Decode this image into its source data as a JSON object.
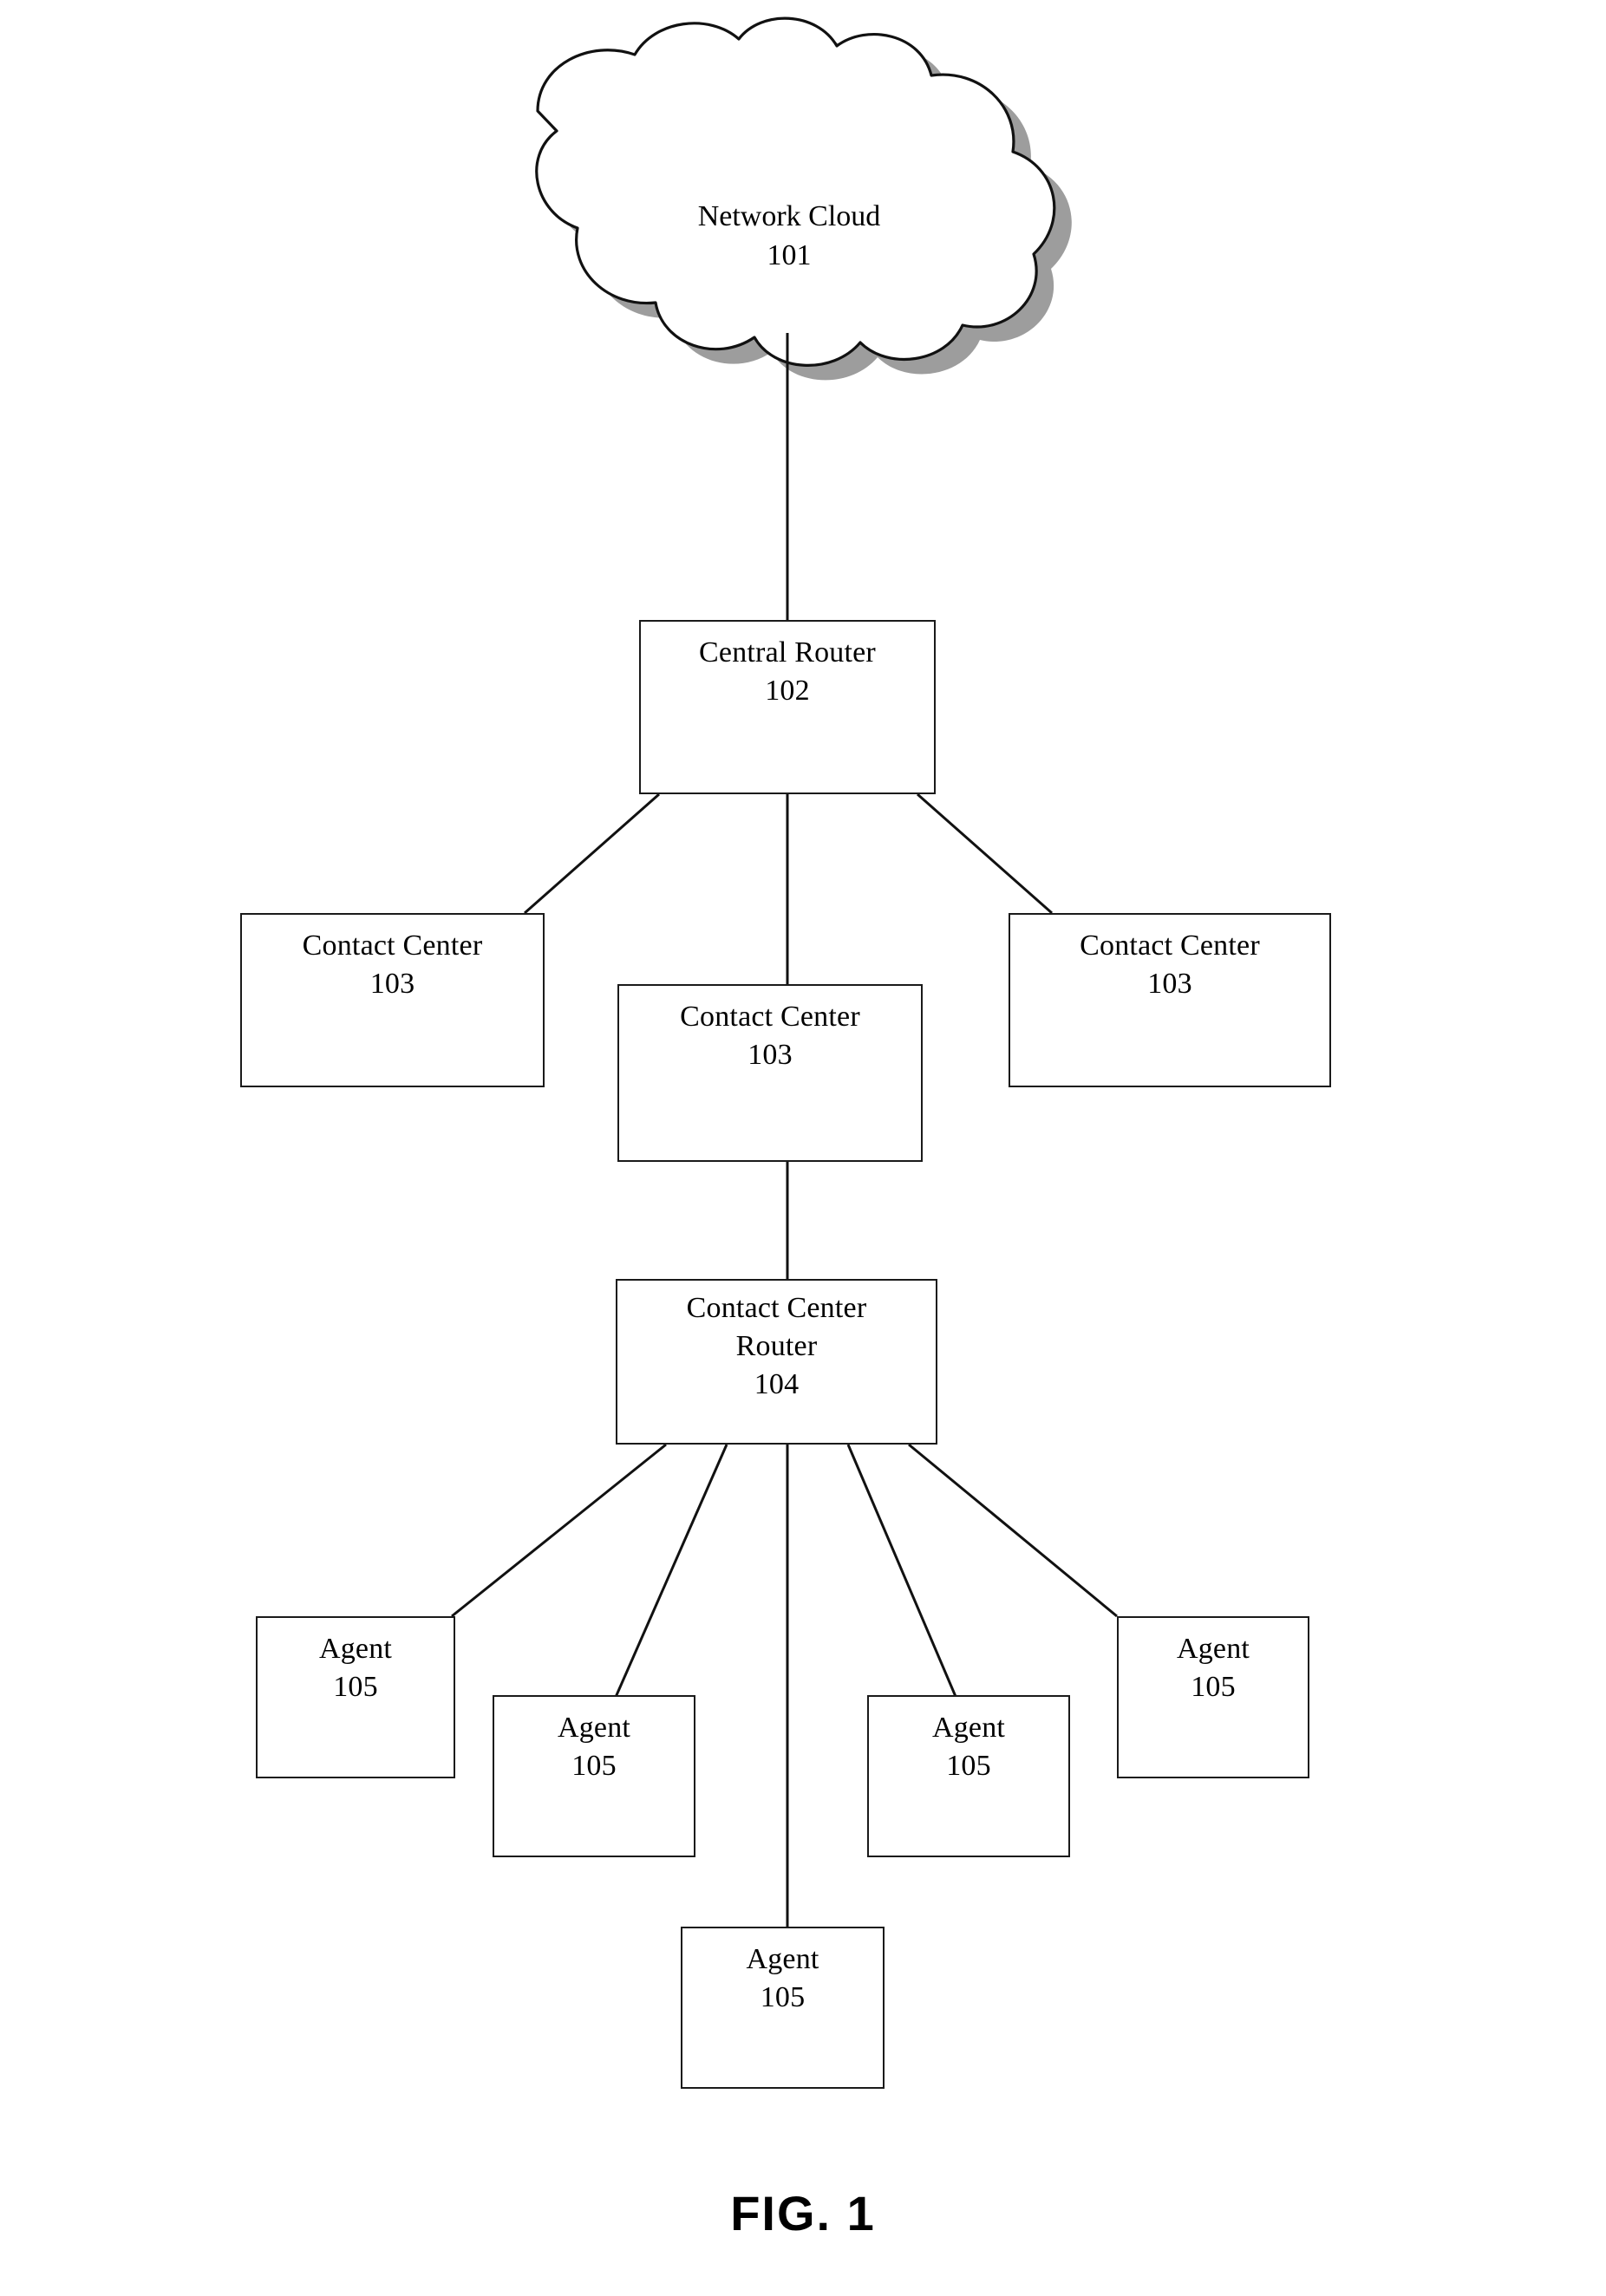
{
  "figure": {
    "caption": "FIG. 1",
    "colors": {
      "ink": "#1a1a1a",
      "paper": "#ffffff",
      "shadow": "#808080"
    }
  },
  "nodes": {
    "cloud": {
      "title": "Network Cloud",
      "ref": "101",
      "shape": "cloud"
    },
    "central_router": {
      "title": "Central Router",
      "ref": "102",
      "shape": "rectangle"
    },
    "contact_center_left": {
      "title": "Contact Center",
      "ref": "103",
      "shape": "rectangle"
    },
    "contact_center_middle": {
      "title": "Contact Center",
      "ref": "103",
      "shape": "rectangle"
    },
    "contact_center_right": {
      "title": "Contact Center",
      "ref": "103",
      "shape": "rectangle"
    },
    "contact_center_router": {
      "title": "Contact Center",
      "title2": "Router",
      "ref": "104",
      "shape": "rectangle"
    },
    "agent_1": {
      "title": "Agent",
      "ref": "105",
      "shape": "rectangle"
    },
    "agent_2": {
      "title": "Agent",
      "ref": "105",
      "shape": "rectangle"
    },
    "agent_3": {
      "title": "Agent",
      "ref": "105",
      "shape": "rectangle"
    },
    "agent_4": {
      "title": "Agent",
      "ref": "105",
      "shape": "rectangle"
    },
    "agent_5": {
      "title": "Agent",
      "ref": "105",
      "shape": "rectangle"
    }
  },
  "connections": [
    {
      "from": "cloud",
      "to": "central_router"
    },
    {
      "from": "central_router",
      "to": "contact_center_left"
    },
    {
      "from": "central_router",
      "to": "contact_center_middle"
    },
    {
      "from": "central_router",
      "to": "contact_center_right"
    },
    {
      "from": "contact_center_middle",
      "to": "contact_center_router"
    },
    {
      "from": "contact_center_router",
      "to": "agent_1"
    },
    {
      "from": "contact_center_router",
      "to": "agent_2"
    },
    {
      "from": "contact_center_router",
      "to": "agent_3"
    },
    {
      "from": "contact_center_router",
      "to": "agent_4"
    },
    {
      "from": "contact_center_router",
      "to": "agent_5"
    }
  ]
}
